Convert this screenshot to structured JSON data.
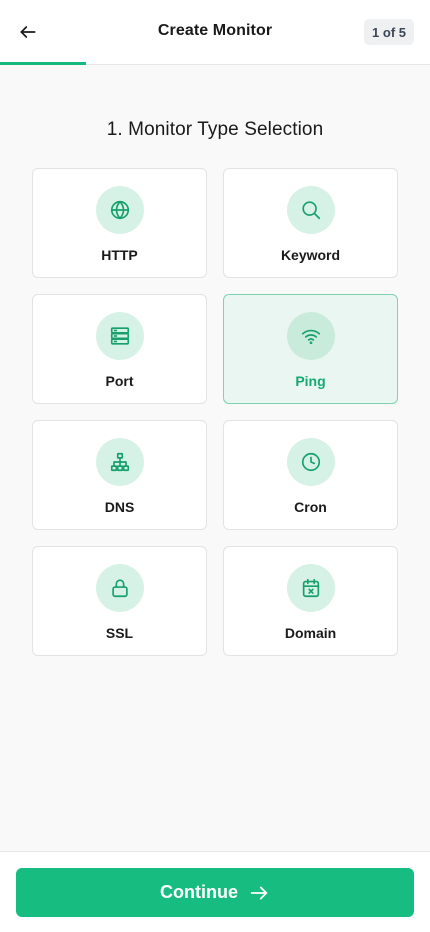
{
  "header": {
    "title": "Create Monitor",
    "step_badge": "1 of 5",
    "back_icon": "arrow-left-icon",
    "progress_fraction": 0.2
  },
  "section": {
    "title": "1. Monitor Type Selection"
  },
  "monitor_types": [
    {
      "label": "HTTP",
      "icon": "globe-icon",
      "selected": false
    },
    {
      "label": "Keyword",
      "icon": "search-icon",
      "selected": false
    },
    {
      "label": "Port",
      "icon": "server-icon",
      "selected": false
    },
    {
      "label": "Ping",
      "icon": "wifi-icon",
      "selected": true
    },
    {
      "label": "DNS",
      "icon": "network-icon",
      "selected": false
    },
    {
      "label": "Cron",
      "icon": "clock-icon",
      "selected": false
    },
    {
      "label": "SSL",
      "icon": "lock-icon",
      "selected": false
    },
    {
      "label": "Domain",
      "icon": "calendar-x-icon",
      "selected": false
    }
  ],
  "footer": {
    "continue_label": "Continue",
    "continue_icon": "arrow-right-icon"
  },
  "colors": {
    "accent": "#17bd80",
    "accent_text": "#16a874",
    "icon_bg": "#d6f1e5",
    "selected_bg": "#eaf6f1"
  }
}
